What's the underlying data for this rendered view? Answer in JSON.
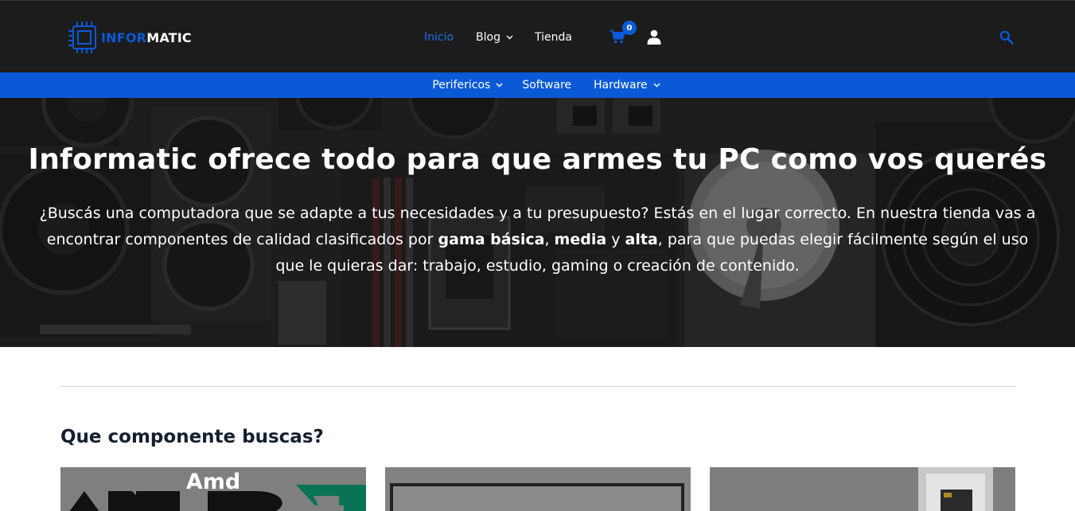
{
  "brand": {
    "logo_part1": "INFOR",
    "logo_part2": "MATIC",
    "accent_color": "#0a5ad8",
    "header_bg": "#1c1c1c"
  },
  "main_nav": {
    "items": [
      {
        "label": "Inicio",
        "active": true
      },
      {
        "label": "Blog",
        "has_dropdown": true
      },
      {
        "label": "Tienda"
      }
    ],
    "cart_icon": "cart-icon",
    "cart_count": "0",
    "account_icon": "user-icon",
    "search_icon": "search-icon"
  },
  "sub_nav": {
    "items": [
      {
        "label": "Perifericos",
        "has_dropdown": true
      },
      {
        "label": "Software"
      },
      {
        "label": "Hardware",
        "has_dropdown": true
      }
    ]
  },
  "hero": {
    "title": "Informatic ofrece todo para que armes tu PC como vos querés",
    "text_1": "¿Buscás una computadora que se adapte a tus necesidades y a tu presupuesto? Estás en el lugar correcto. En nuestra tienda vas a encontrar componentes de calidad clasificados por ",
    "bold_1": "gama básica",
    "sep_1": ", ",
    "bold_2": "media",
    "sep_2": " y ",
    "bold_3": "alta",
    "text_2": ", para que puedas elegir fácilmente según el uso que le quieras dar: trabajo, estudio, gaming o creación de contenido."
  },
  "components": {
    "title": "Que componente buscas?",
    "cards": [
      {
        "label": "Amd"
      },
      {
        "label": ""
      },
      {
        "label": ""
      }
    ]
  }
}
